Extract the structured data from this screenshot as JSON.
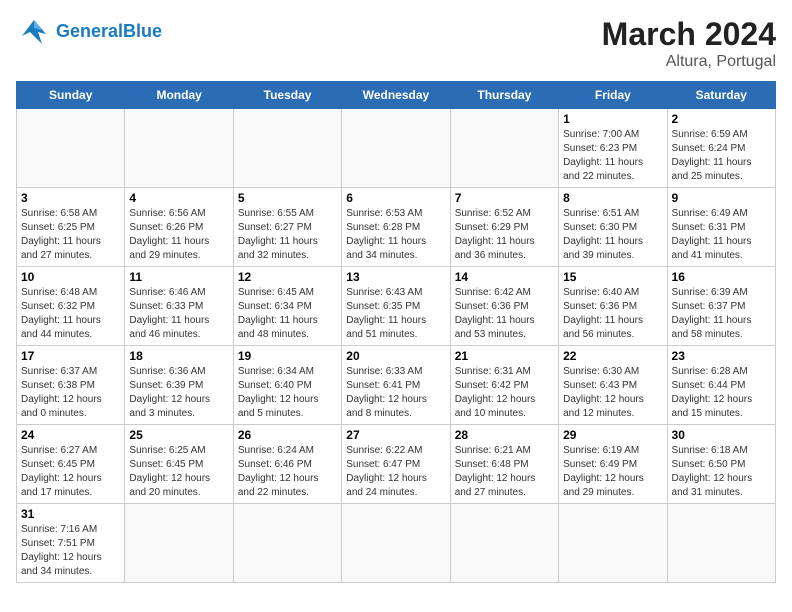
{
  "header": {
    "logo_general": "General",
    "logo_blue": "Blue",
    "month_title": "March 2024",
    "location": "Altura, Portugal"
  },
  "weekdays": [
    "Sunday",
    "Monday",
    "Tuesday",
    "Wednesday",
    "Thursday",
    "Friday",
    "Saturday"
  ],
  "weeks": [
    [
      {
        "day": "",
        "info": ""
      },
      {
        "day": "",
        "info": ""
      },
      {
        "day": "",
        "info": ""
      },
      {
        "day": "",
        "info": ""
      },
      {
        "day": "",
        "info": ""
      },
      {
        "day": "1",
        "info": "Sunrise: 7:00 AM\nSunset: 6:23 PM\nDaylight: 11 hours\nand 22 minutes."
      },
      {
        "day": "2",
        "info": "Sunrise: 6:59 AM\nSunset: 6:24 PM\nDaylight: 11 hours\nand 25 minutes."
      }
    ],
    [
      {
        "day": "3",
        "info": "Sunrise: 6:58 AM\nSunset: 6:25 PM\nDaylight: 11 hours\nand 27 minutes."
      },
      {
        "day": "4",
        "info": "Sunrise: 6:56 AM\nSunset: 6:26 PM\nDaylight: 11 hours\nand 29 minutes."
      },
      {
        "day": "5",
        "info": "Sunrise: 6:55 AM\nSunset: 6:27 PM\nDaylight: 11 hours\nand 32 minutes."
      },
      {
        "day": "6",
        "info": "Sunrise: 6:53 AM\nSunset: 6:28 PM\nDaylight: 11 hours\nand 34 minutes."
      },
      {
        "day": "7",
        "info": "Sunrise: 6:52 AM\nSunset: 6:29 PM\nDaylight: 11 hours\nand 36 minutes."
      },
      {
        "day": "8",
        "info": "Sunrise: 6:51 AM\nSunset: 6:30 PM\nDaylight: 11 hours\nand 39 minutes."
      },
      {
        "day": "9",
        "info": "Sunrise: 6:49 AM\nSunset: 6:31 PM\nDaylight: 11 hours\nand 41 minutes."
      }
    ],
    [
      {
        "day": "10",
        "info": "Sunrise: 6:48 AM\nSunset: 6:32 PM\nDaylight: 11 hours\nand 44 minutes."
      },
      {
        "day": "11",
        "info": "Sunrise: 6:46 AM\nSunset: 6:33 PM\nDaylight: 11 hours\nand 46 minutes."
      },
      {
        "day": "12",
        "info": "Sunrise: 6:45 AM\nSunset: 6:34 PM\nDaylight: 11 hours\nand 48 minutes."
      },
      {
        "day": "13",
        "info": "Sunrise: 6:43 AM\nSunset: 6:35 PM\nDaylight: 11 hours\nand 51 minutes."
      },
      {
        "day": "14",
        "info": "Sunrise: 6:42 AM\nSunset: 6:36 PM\nDaylight: 11 hours\nand 53 minutes."
      },
      {
        "day": "15",
        "info": "Sunrise: 6:40 AM\nSunset: 6:36 PM\nDaylight: 11 hours\nand 56 minutes."
      },
      {
        "day": "16",
        "info": "Sunrise: 6:39 AM\nSunset: 6:37 PM\nDaylight: 11 hours\nand 58 minutes."
      }
    ],
    [
      {
        "day": "17",
        "info": "Sunrise: 6:37 AM\nSunset: 6:38 PM\nDaylight: 12 hours\nand 0 minutes."
      },
      {
        "day": "18",
        "info": "Sunrise: 6:36 AM\nSunset: 6:39 PM\nDaylight: 12 hours\nand 3 minutes."
      },
      {
        "day": "19",
        "info": "Sunrise: 6:34 AM\nSunset: 6:40 PM\nDaylight: 12 hours\nand 5 minutes."
      },
      {
        "day": "20",
        "info": "Sunrise: 6:33 AM\nSunset: 6:41 PM\nDaylight: 12 hours\nand 8 minutes."
      },
      {
        "day": "21",
        "info": "Sunrise: 6:31 AM\nSunset: 6:42 PM\nDaylight: 12 hours\nand 10 minutes."
      },
      {
        "day": "22",
        "info": "Sunrise: 6:30 AM\nSunset: 6:43 PM\nDaylight: 12 hours\nand 12 minutes."
      },
      {
        "day": "23",
        "info": "Sunrise: 6:28 AM\nSunset: 6:44 PM\nDaylight: 12 hours\nand 15 minutes."
      }
    ],
    [
      {
        "day": "24",
        "info": "Sunrise: 6:27 AM\nSunset: 6:45 PM\nDaylight: 12 hours\nand 17 minutes."
      },
      {
        "day": "25",
        "info": "Sunrise: 6:25 AM\nSunset: 6:45 PM\nDaylight: 12 hours\nand 20 minutes."
      },
      {
        "day": "26",
        "info": "Sunrise: 6:24 AM\nSunset: 6:46 PM\nDaylight: 12 hours\nand 22 minutes."
      },
      {
        "day": "27",
        "info": "Sunrise: 6:22 AM\nSunset: 6:47 PM\nDaylight: 12 hours\nand 24 minutes."
      },
      {
        "day": "28",
        "info": "Sunrise: 6:21 AM\nSunset: 6:48 PM\nDaylight: 12 hours\nand 27 minutes."
      },
      {
        "day": "29",
        "info": "Sunrise: 6:19 AM\nSunset: 6:49 PM\nDaylight: 12 hours\nand 29 minutes."
      },
      {
        "day": "30",
        "info": "Sunrise: 6:18 AM\nSunset: 6:50 PM\nDaylight: 12 hours\nand 31 minutes."
      }
    ],
    [
      {
        "day": "31",
        "info": "Sunrise: 7:16 AM\nSunset: 7:51 PM\nDaylight: 12 hours\nand 34 minutes."
      },
      {
        "day": "",
        "info": ""
      },
      {
        "day": "",
        "info": ""
      },
      {
        "day": "",
        "info": ""
      },
      {
        "day": "",
        "info": ""
      },
      {
        "day": "",
        "info": ""
      },
      {
        "day": "",
        "info": ""
      }
    ]
  ]
}
